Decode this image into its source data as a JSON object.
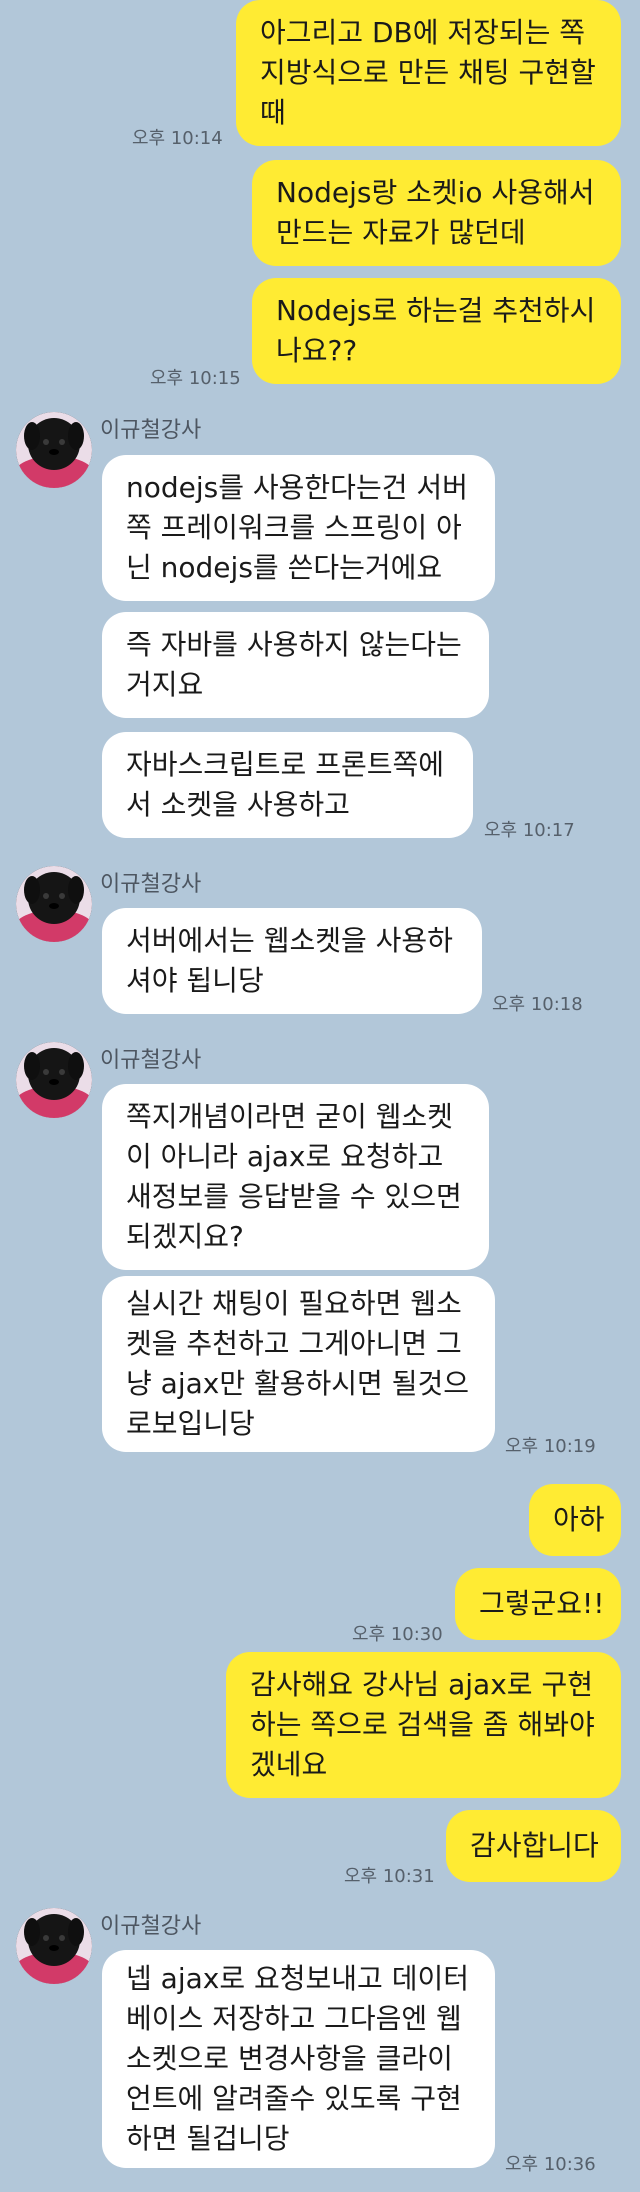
{
  "messages": [
    {
      "from": "me",
      "lines": [
        "아그리고 DB에 저장되는 쪽",
        "지방식으로 만든 채팅 구현할",
        "때"
      ],
      "time": "오후 10:14"
    },
    {
      "from": "me",
      "lines": [
        "Nodejs랑 소켓io 사용해서",
        "만드는 자료가 많던데"
      ],
      "time": ""
    },
    {
      "from": "me",
      "lines": [
        "Nodejs로 하는걸 추천하시",
        "나요??"
      ],
      "time": "오후 10:15"
    },
    {
      "from": "them",
      "sender": "이규철강사",
      "lines": [
        "nodejs를 사용한다는건 서버",
        "쪽 프레이워크를 스프링이 아",
        "닌 nodejs를 쓴다는거에요"
      ],
      "time": ""
    },
    {
      "from": "them",
      "lines": [
        "즉 자바를 사용하지 않는다는",
        "거지요"
      ],
      "time": ""
    },
    {
      "from": "them",
      "lines": [
        "자바스크립트로 프론트쪽에",
        "서 소켓을 사용하고"
      ],
      "time": "오후 10:17"
    },
    {
      "from": "them",
      "sender": "이규철강사",
      "lines": [
        "서버에서는 웹소켓을 사용하",
        "셔야 됩니당"
      ],
      "time": "오후 10:18"
    },
    {
      "from": "them",
      "sender": "이규철강사",
      "lines": [
        "쪽지개념이라면 굳이 웹소켓",
        "이 아니라 ajax로 요청하고",
        "새정보를 응답받을 수 있으면",
        "되겠지요?"
      ],
      "time": ""
    },
    {
      "from": "them",
      "lines": [
        "실시간 채팅이 필요하면 웹소",
        "켓을 추천하고 그게아니면 그",
        "냥 ajax만 활용하시면 될것으",
        "로보입니당"
      ],
      "time": "오후 10:19"
    },
    {
      "from": "me",
      "lines": [
        "아하"
      ],
      "time": ""
    },
    {
      "from": "me",
      "lines": [
        "그렇군요!!"
      ],
      "time": "오후 10:30"
    },
    {
      "from": "me",
      "lines": [
        "감사해요 강사님 ajax로 구현",
        "하는 쪽으로 검색을 좀 해봐야",
        "겠네요"
      ],
      "time": ""
    },
    {
      "from": "me",
      "lines": [
        "감사합니다"
      ],
      "time": "오후 10:31"
    },
    {
      "from": "them",
      "sender": "이규철강사",
      "lines": [
        "넵 ajax로 요청보내고 데이터",
        "베이스 저장하고 그다음엔 웹",
        "소켓으로 변경사항을 클라이",
        "언트에 알려줄수 있도록 구현",
        "하면 될겁니당"
      ],
      "time": "오후 10:36"
    }
  ]
}
